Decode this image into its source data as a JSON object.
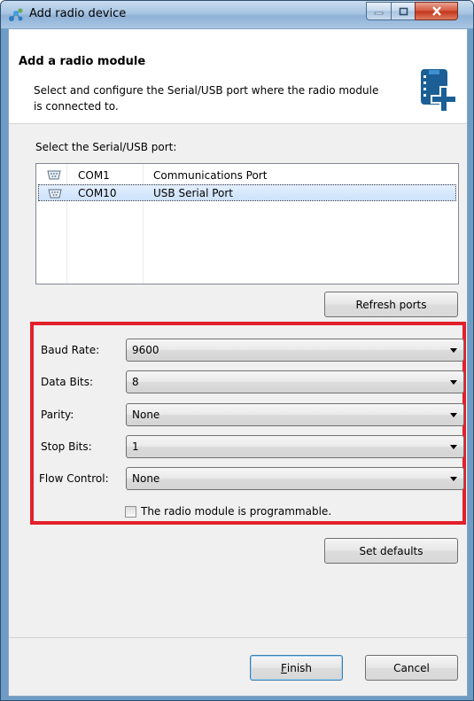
{
  "window": {
    "title": "Add radio device"
  },
  "header": {
    "title": "Add a radio module",
    "description": "Select and configure the Serial/USB port where the radio module is connected to."
  },
  "ports": {
    "label": "Select the Serial/USB port:",
    "rows": [
      {
        "port": "COM1",
        "description": "Communications Port",
        "selected": false
      },
      {
        "port": "COM10",
        "description": "USB Serial Port",
        "selected": true
      }
    ],
    "refresh_label": "Refresh ports"
  },
  "settings": {
    "baud_rate": {
      "label": "Baud Rate:",
      "value": "9600"
    },
    "data_bits": {
      "label": "Data Bits:",
      "value": "8"
    },
    "parity": {
      "label": "Parity:",
      "value": "None"
    },
    "stop_bits": {
      "label": "Stop Bits:",
      "value": "1"
    },
    "flow_control": {
      "label": "Flow Control:",
      "value": "None"
    },
    "programmable": {
      "label": "The radio module is programmable.",
      "checked": false
    },
    "defaults_label": "Set defaults"
  },
  "footer": {
    "finish_accel": "F",
    "finish_rest": "inish",
    "cancel_label": "Cancel"
  },
  "colors": {
    "highlight": "#e3202a",
    "selection": "#cde2fb",
    "brand_icon": "#1b5f96"
  },
  "icons": {
    "title": "radio-network-icon",
    "header": "radio-module-add-icon",
    "port": "serial-port-icon"
  }
}
